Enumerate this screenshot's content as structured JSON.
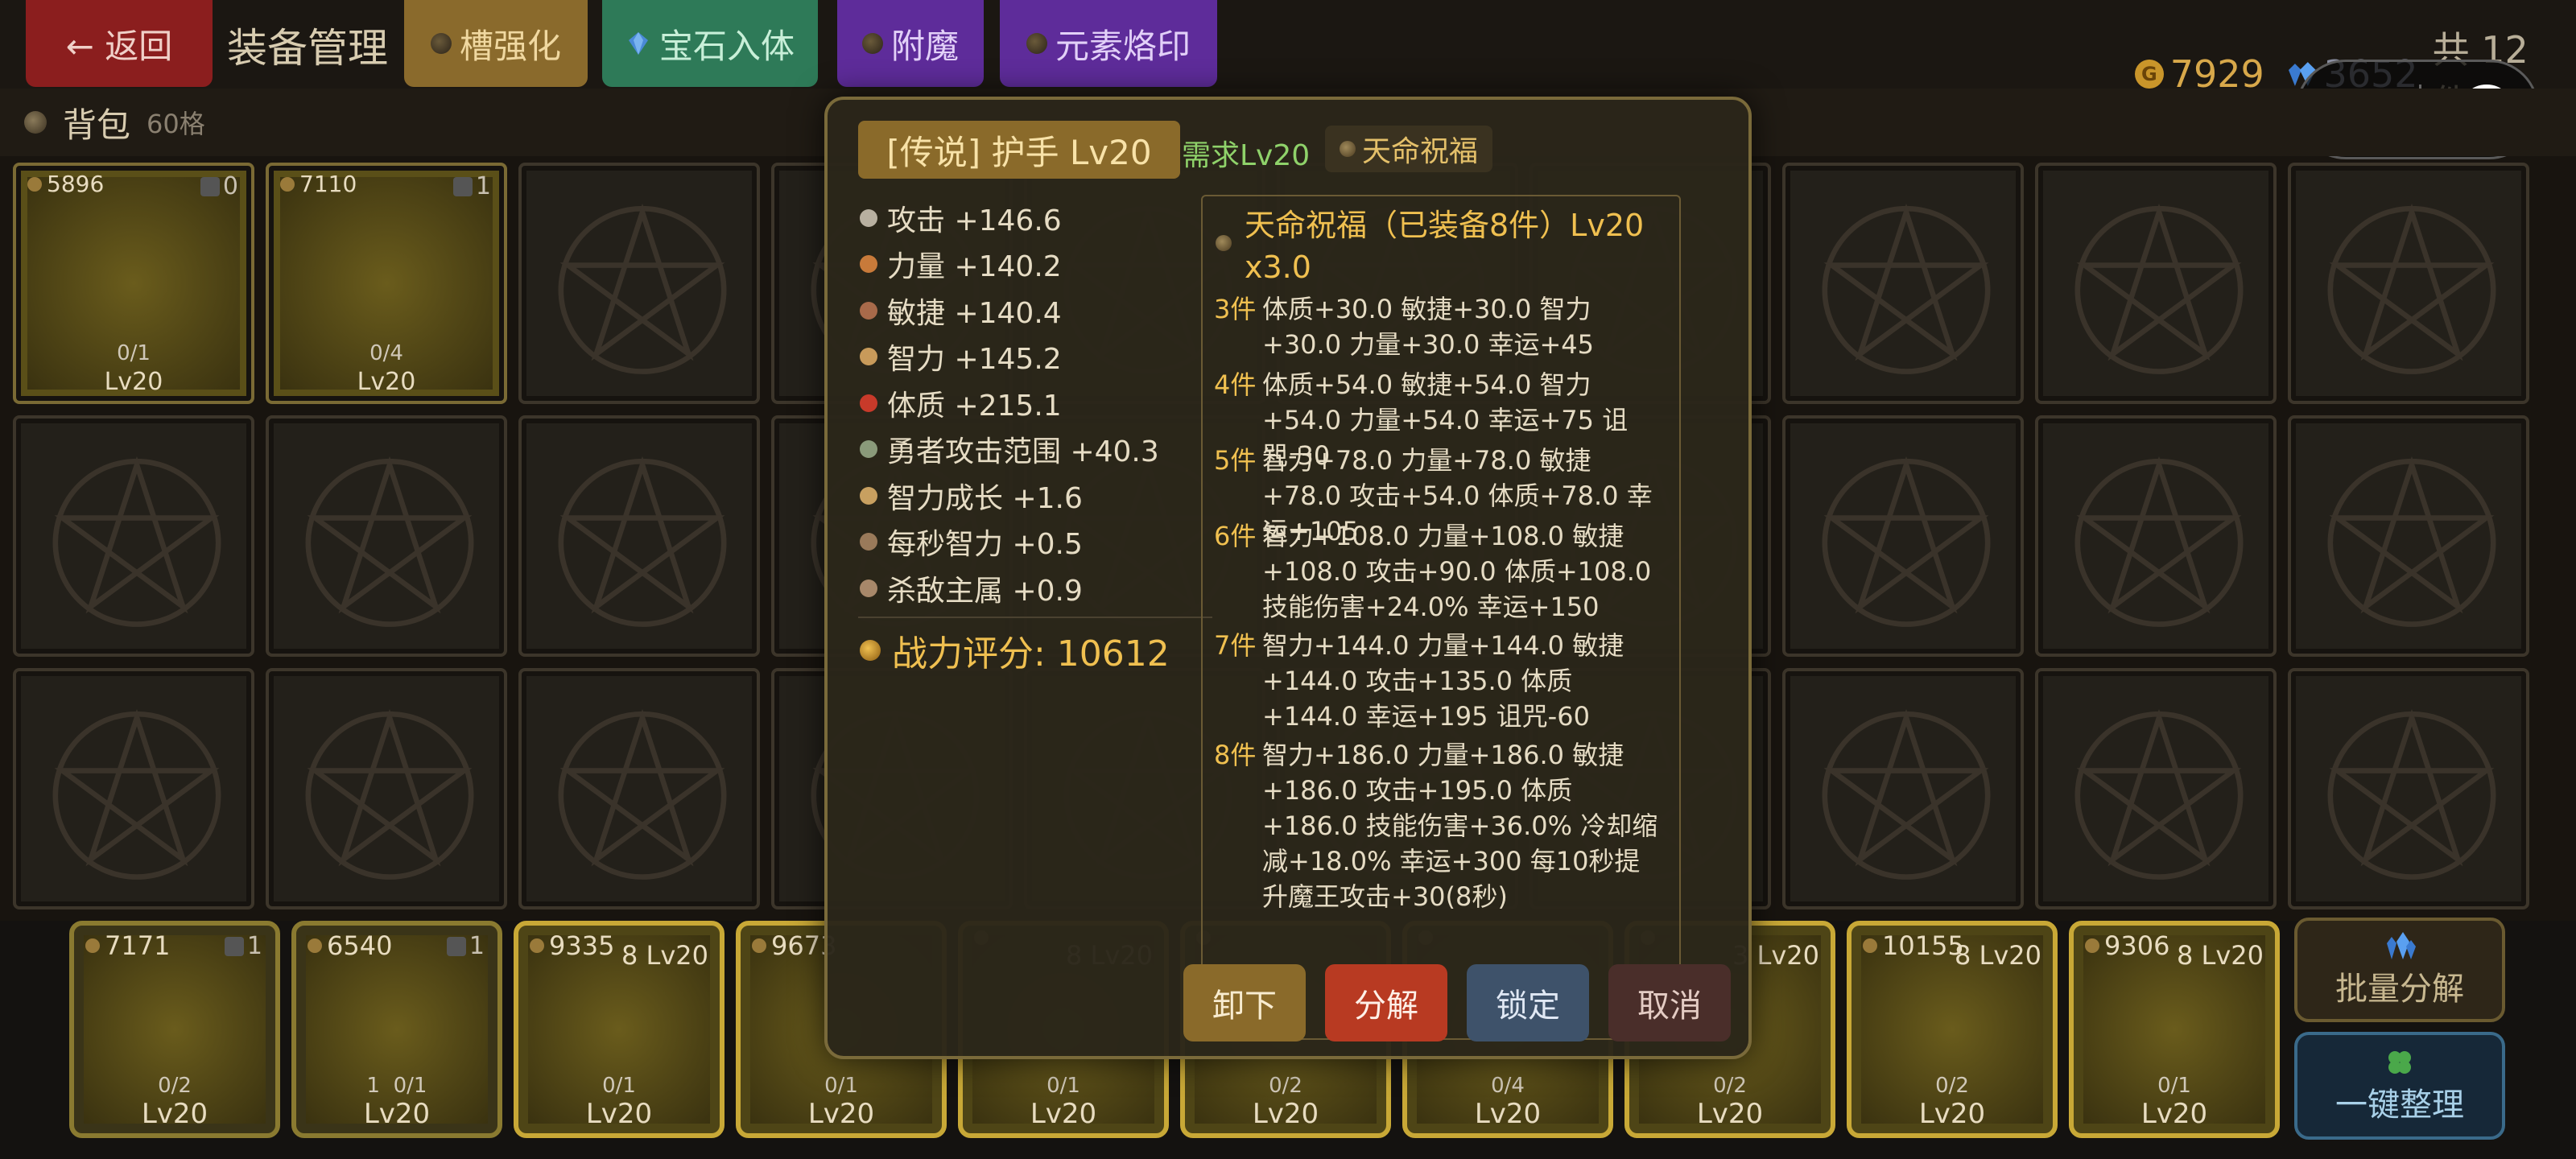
{
  "topbar": {
    "back_label": "← 返回",
    "title": "装备管理",
    "tabs": [
      "槽强化",
      "宝石入体",
      "附魔",
      "元素烙印"
    ],
    "gold": "7929",
    "gems": "3652",
    "total": "共 12 件"
  },
  "bag": {
    "title": "背包",
    "capacity": "60格"
  },
  "grid_items": [
    {
      "power": "5896",
      "lock": "0",
      "slots": "0/1",
      "level": "Lv20"
    },
    {
      "power": "7110",
      "lock": "1",
      "slots": "0/4",
      "level": "Lv20"
    }
  ],
  "equipped": [
    {
      "power": "7171",
      "lock": "1",
      "slots": "0/2",
      "level": "Lv20",
      "lv_tag": ""
    },
    {
      "power": "6540",
      "lock": "1",
      "slots": "0/1",
      "extra": "1",
      "level": "Lv20",
      "lv_tag": ""
    },
    {
      "power": "9335",
      "slots": "0/1",
      "level": "Lv20",
      "lv_tag": "8 Lv20"
    },
    {
      "power": "9673",
      "slots": "0/1",
      "level": "Lv20",
      "lv_tag": ""
    },
    {
      "power": "",
      "slots": "0/1",
      "level": "Lv20",
      "lv_tag": "8 Lv20"
    },
    {
      "power": "",
      "slots": "0/2",
      "level": "Lv20",
      "lv_tag": ""
    },
    {
      "power": "",
      "slots": "0/4",
      "level": "Lv20",
      "lv_tag": ""
    },
    {
      "power": "",
      "slots": "0/2",
      "level": "Lv20",
      "lv_tag": "3 Lv20"
    },
    {
      "power": "10155",
      "slots": "0/2",
      "level": "Lv20",
      "lv_tag": "8 Lv20"
    },
    {
      "power": "9306",
      "slots": "0/1",
      "level": "Lv20",
      "lv_tag": "8 Lv20"
    }
  ],
  "side_buttons": {
    "batch": "批量分解",
    "sort": "一键整理"
  },
  "tooltip": {
    "title": "[传说] 护手 Lv20",
    "requirement": "需求Lv20",
    "set_badge": "天命祝福",
    "stats": [
      {
        "label": "攻击 +146.6",
        "color": "#b8b0a0"
      },
      {
        "label": "力量 +140.2",
        "color": "#c87a3a"
      },
      {
        "label": "敏捷 +140.4",
        "color": "#a86a4a"
      },
      {
        "label": "智力 +145.2",
        "color": "#c89a5a"
      },
      {
        "label": "体质 +215.1",
        "color": "#c83a2a"
      },
      {
        "label": "勇者攻击范围 +40.3",
        "color": "#8a9a7a"
      },
      {
        "label": "智力成长 +1.6",
        "color": "#c8a060"
      },
      {
        "label": "每秒智力 +0.5",
        "color": "#9a7a5a"
      },
      {
        "label": "杀敌主属 +0.9",
        "color": "#a8886a"
      }
    ],
    "score": "战力评分: 10612",
    "set_name": "天命祝福（已装备8件）Lv20 x3.0",
    "tiers": [
      {
        "n": "3件",
        "d": "体质+30.0 敏捷+30.0 智力+30.0 力量+30.0 幸运+45"
      },
      {
        "n": "4件",
        "d": "体质+54.0 敏捷+54.0 智力+54.0 力量+54.0 幸运+75 诅咒-30"
      },
      {
        "n": "5件",
        "d": "智力+78.0 力量+78.0 敏捷+78.0 攻击+54.0 体质+78.0 幸运+105"
      },
      {
        "n": "6件",
        "d": "智力+108.0 力量+108.0 敏捷+108.0 攻击+90.0 体质+108.0 技能伤害+24.0% 幸运+150"
      },
      {
        "n": "7件",
        "d": "智力+144.0 力量+144.0 敏捷+144.0 攻击+135.0 体质+144.0 幸运+195 诅咒-60"
      },
      {
        "n": "8件",
        "d": "智力+186.0 力量+186.0 敏捷+186.0 攻击+195.0 体质+186.0 技能伤害+36.0% 冷却缩减+18.0% 幸运+300 每10秒提升魔王攻击+30(8秒)"
      }
    ],
    "buttons": {
      "unequip": "卸下",
      "decompose": "分解",
      "lock": "锁定",
      "cancel": "取消"
    }
  }
}
